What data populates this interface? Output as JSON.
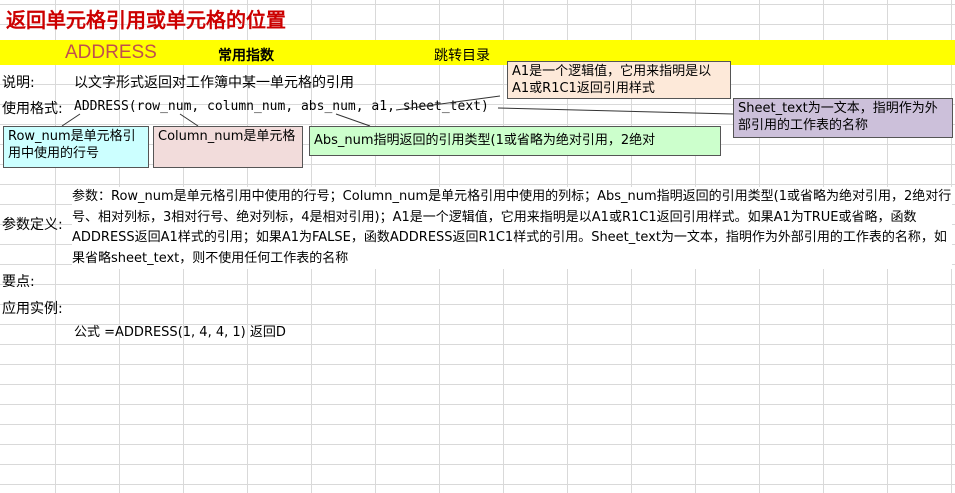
{
  "title": "返回单元格引用或单元格的位置",
  "header": {
    "function_name": "ADDRESS",
    "common_functions": "常用指数",
    "jump_catalog": "跳转目录"
  },
  "labels": {
    "description": "说明:",
    "syntax": "使用格式:",
    "param_def": "参数定义:",
    "key_points": "要点:",
    "example": "应用实例:"
  },
  "description_text": "以文字形式返回对工作簿中某一单元格的引用",
  "syntax_text": "ADDRESS(row_num, column_num, abs_num, a1, sheet_text)",
  "callouts": {
    "a1": "A1是一个逻辑值，它用来指明是以A1或R1C1返回引用样式",
    "sheet_text": "Sheet_text为一文本，指明作为外部引用的工作表的名称",
    "row_num": "Row_num是单元格引用中使用的行号",
    "column_num": "Column_num是单元格",
    "abs_num": "Abs_num指明返回的引用类型(1或省略为绝对引用，2绝对"
  },
  "params_text": "参数：Row_num是单元格引用中使用的行号；Column_num是单元格引用中使用的列标；Abs_num指明返回的引用类型(1或省略为绝对引用，2绝对行号、相对列标，3相对行号、绝对列标，4是相对引用)；A1是一个逻辑值，它用来指明是以A1或R1C1返回引用样式。如果A1为TRUE或省略，函数ADDRESS返回A1样式的引用；如果A1为FALSE，函数ADDRESS返回R1C1样式的引用。Sheet_text为一文本，指明作为外部引用的工作表的名称，如果省略sheet_text，则不使用任何工作表的名称",
  "example_text": "公式 =ADDRESS(1, 4, 4, 1)  返回D",
  "colors": {
    "title": "#cc0000",
    "header_bar": "#ffff00",
    "row_num_box": "#ccffff",
    "column_num_box": "#f2dcdb",
    "abs_num_box": "#ccffcc",
    "a1_box": "#fde9d9",
    "sheet_text_box": "#ccc0da"
  }
}
